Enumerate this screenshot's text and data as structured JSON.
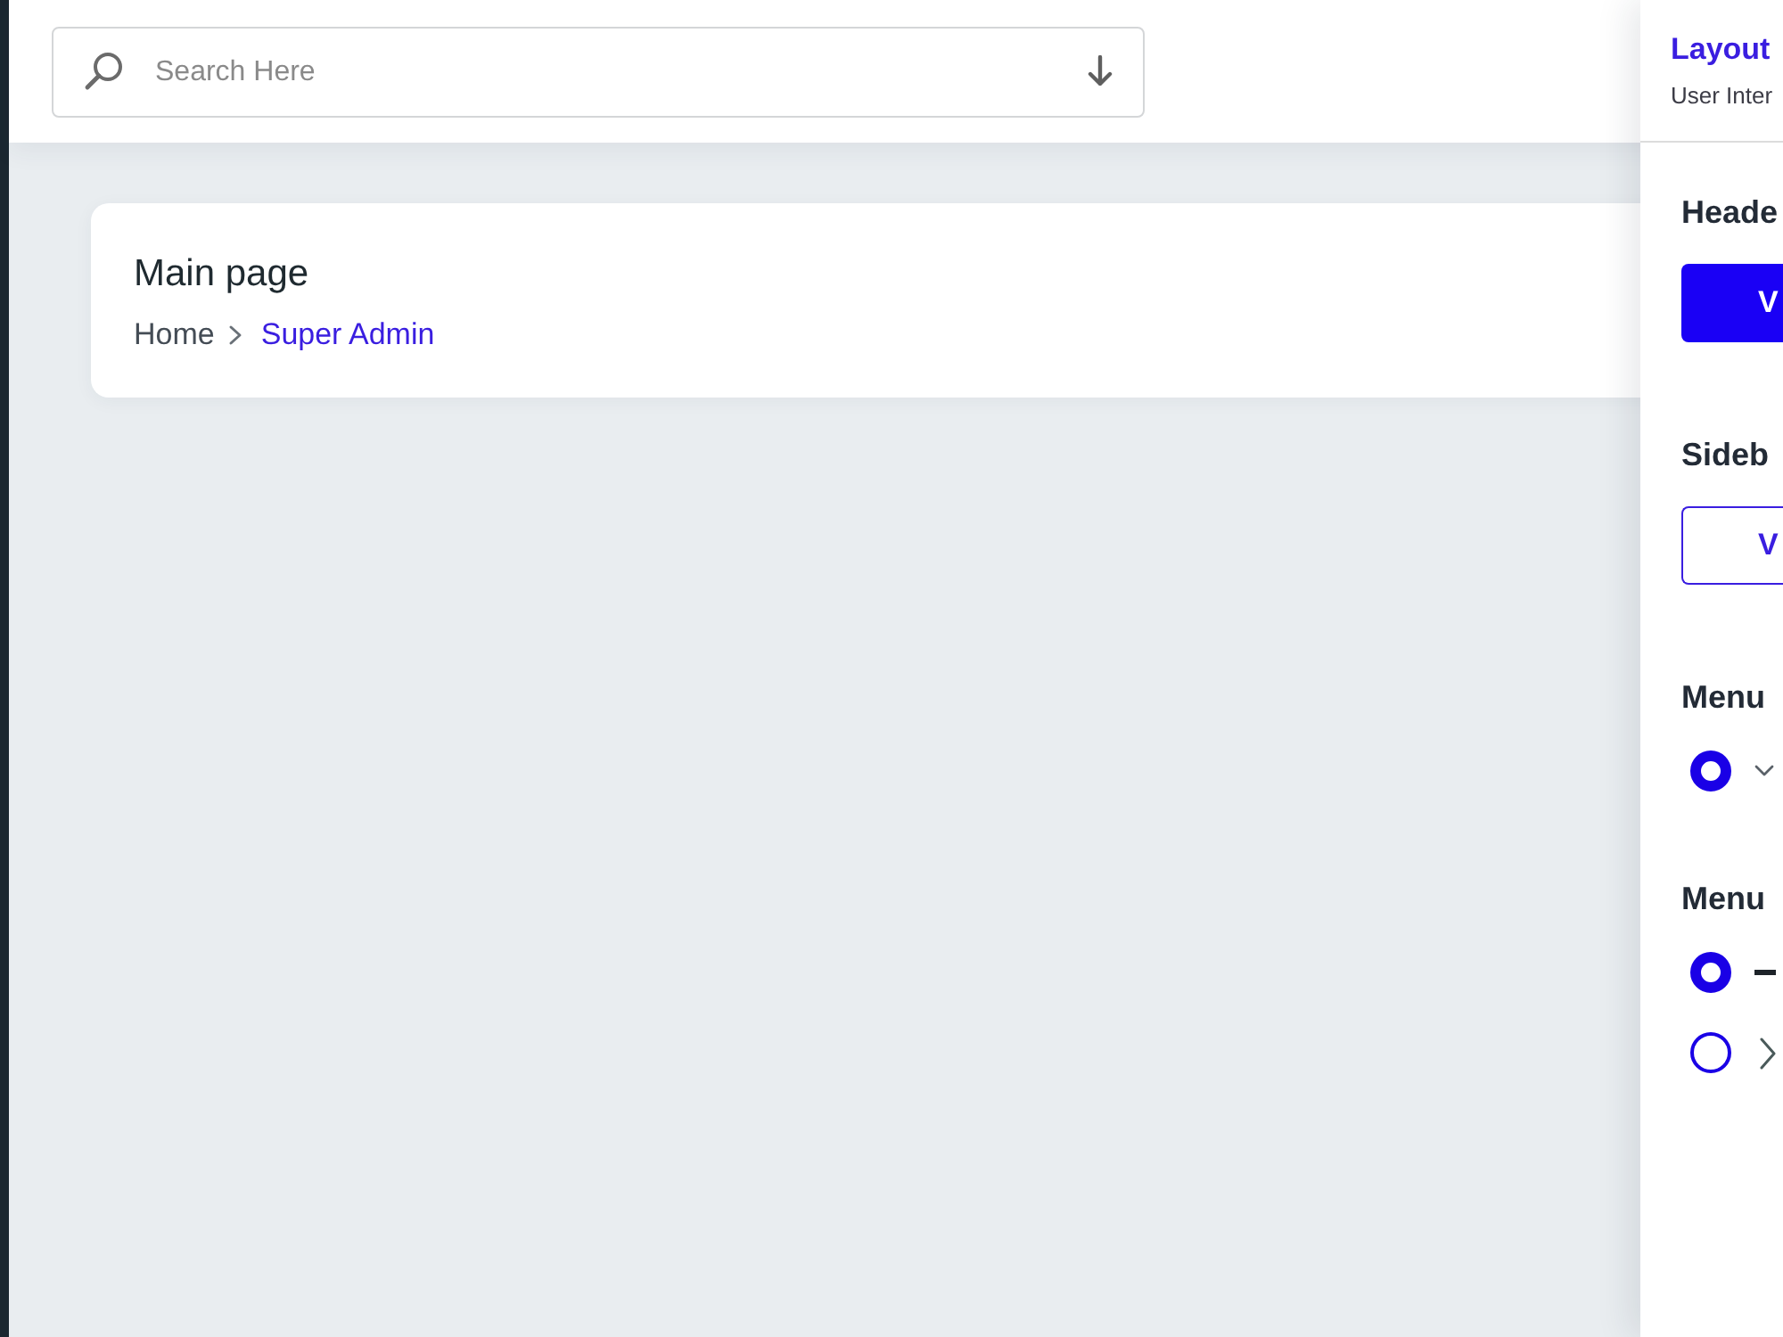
{
  "header": {
    "search": {
      "placeholder": "Search Here"
    }
  },
  "page_card": {
    "title": "Main page",
    "breadcrumb": [
      {
        "label": "Home",
        "current": false
      },
      {
        "label": "Super Admin",
        "current": true
      }
    ]
  },
  "settings_panel": {
    "title": "Layout",
    "subtitle": "User Inter",
    "sections": [
      {
        "kind": "buttons",
        "heading": "Heade",
        "buttons": [
          {
            "label": "V",
            "selected": true
          }
        ]
      },
      {
        "kind": "buttons",
        "heading": "Sideb",
        "buttons": [
          {
            "label": "V",
            "selected": false
          }
        ]
      },
      {
        "kind": "radios",
        "heading": "Menu",
        "options": [
          {
            "kind": "chevron-down",
            "selected": true
          }
        ]
      },
      {
        "kind": "radios",
        "heading": "Menu",
        "options": [
          {
            "kind": "dash",
            "selected": true
          },
          {
            "kind": "chevron-right",
            "selected": false
          }
        ]
      }
    ]
  }
}
